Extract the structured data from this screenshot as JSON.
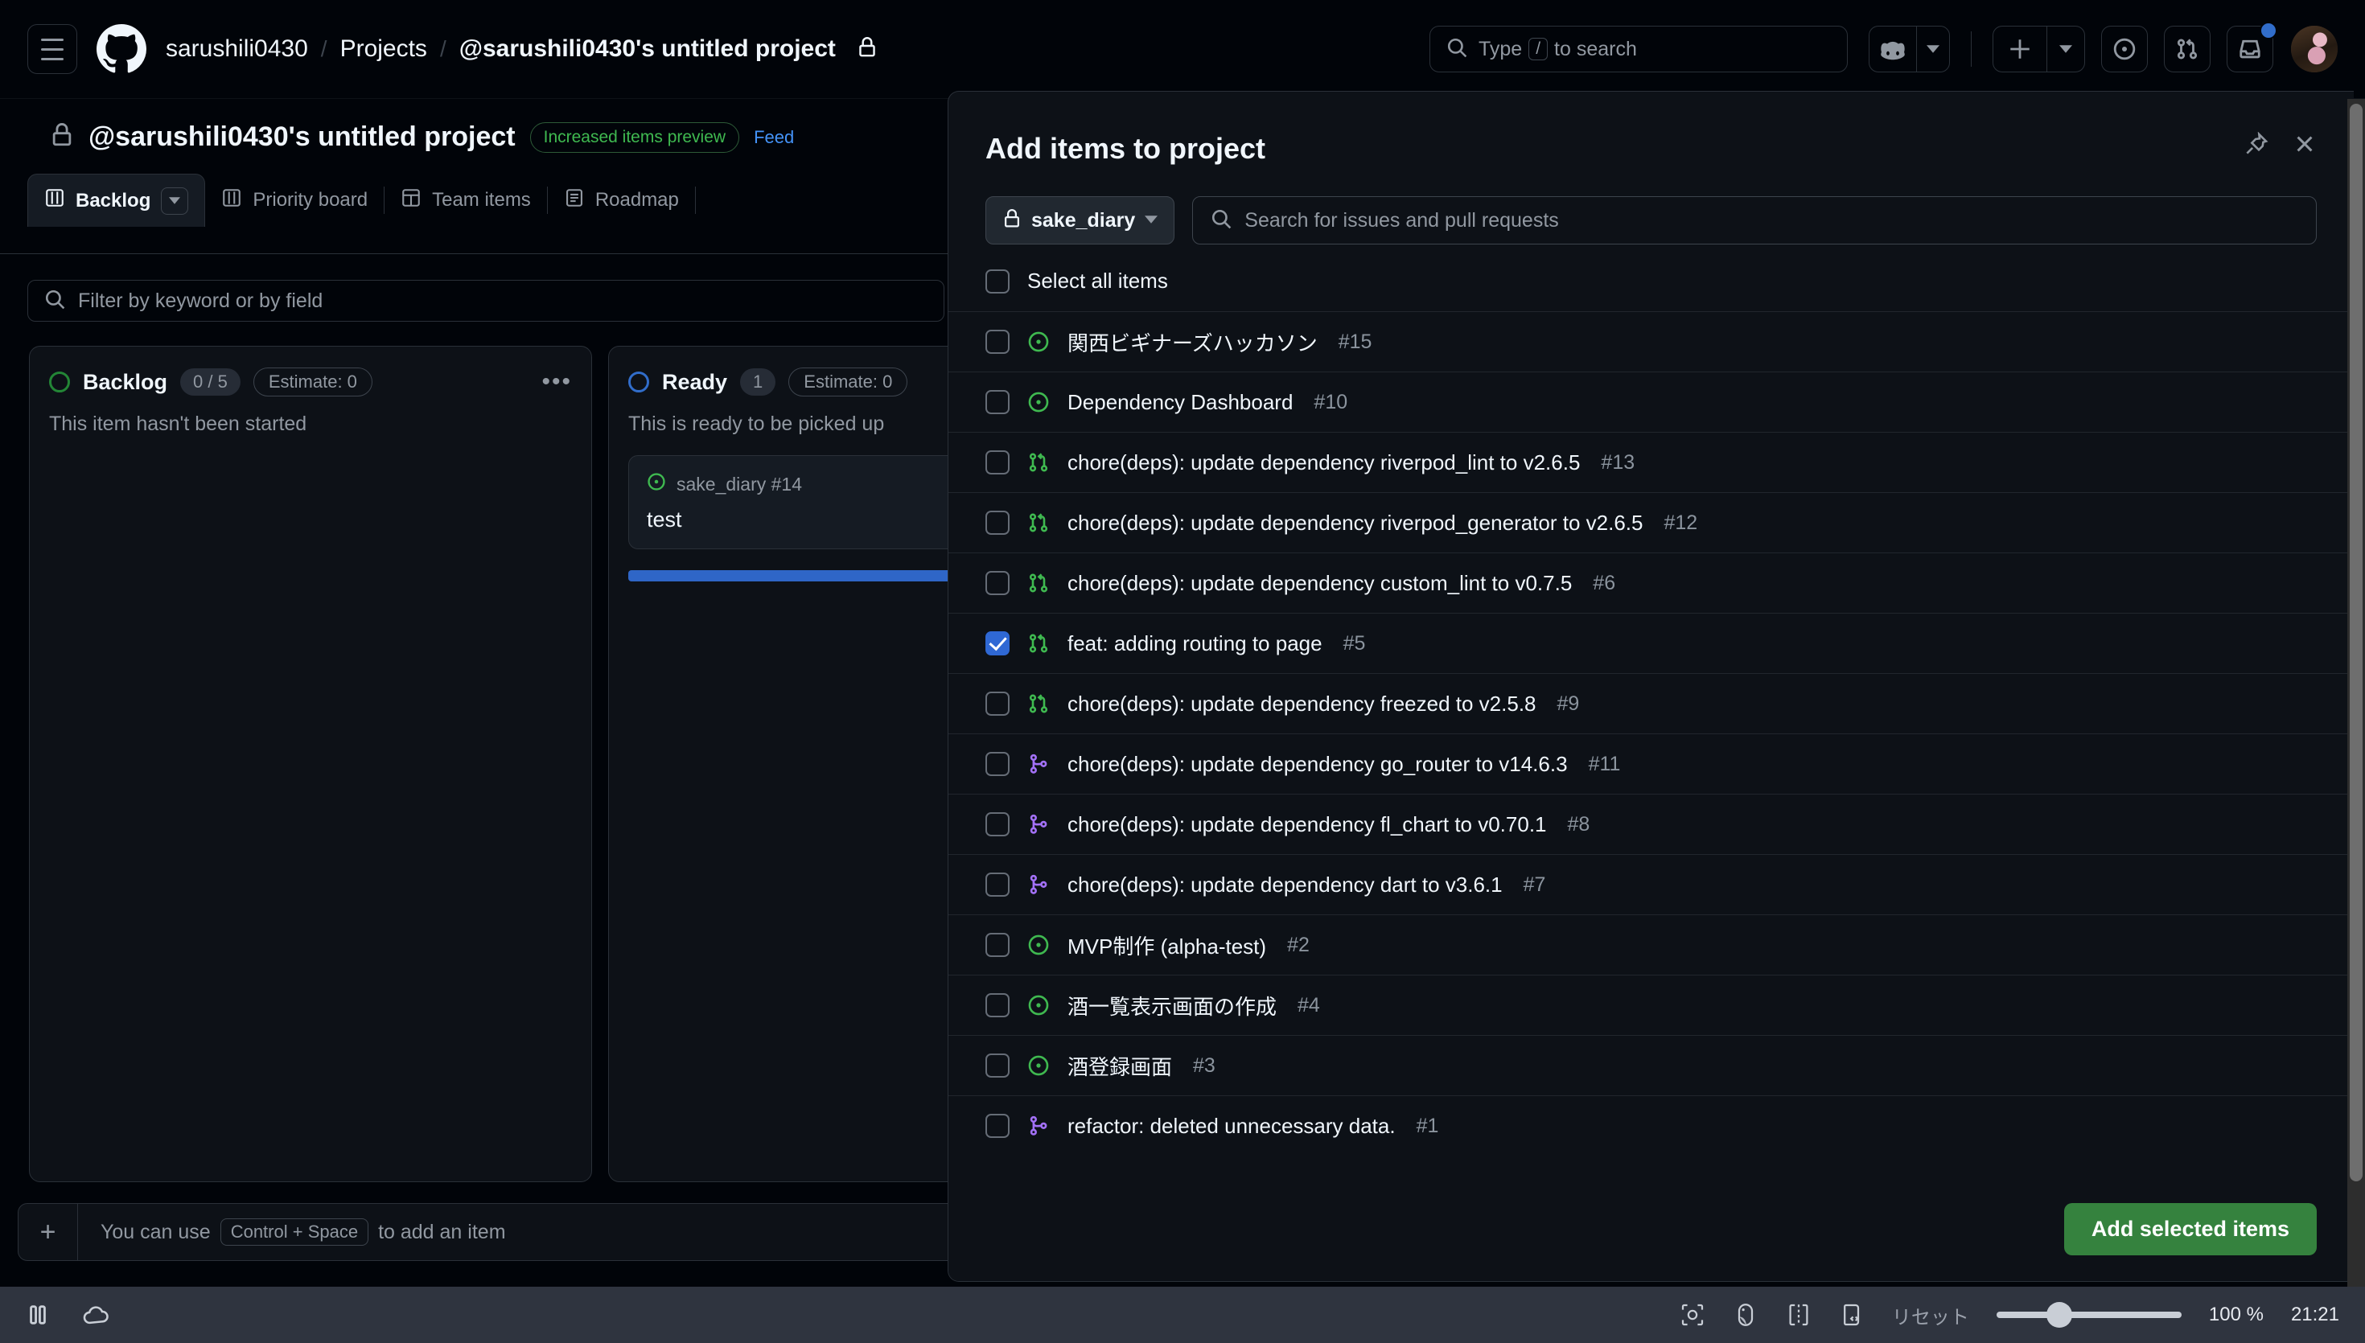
{
  "header": {
    "menu_icon": "hamburger-icon",
    "logo_icon": "github-logo-icon",
    "breadcrumb": {
      "owner": "sarushili0430",
      "sep": "/",
      "section": "Projects",
      "project": "@sarushili0430's untitled project",
      "lock_icon": "lock-icon"
    },
    "search": {
      "placeholder_prefix": "Type",
      "key": "/",
      "placeholder_suffix": "to search",
      "icon": "search-icon"
    },
    "copilot_icon": "copilot-icon",
    "copilot_caret_icon": "chevron-down-icon",
    "plus_icon": "plus-icon",
    "plus_caret_icon": "chevron-down-icon",
    "issues_icon": "issue-opened-icon",
    "pulls_icon": "git-pull-request-icon",
    "inbox_icon": "inbox-icon",
    "avatar_icon": "avatar"
  },
  "project": {
    "lock_icon": "lock-icon",
    "title": "@sarushili0430's untitled project",
    "preview_badge": "Increased items preview",
    "feedback_link": "Feed",
    "tabs": [
      {
        "label": "Backlog",
        "icon": "board-view-icon",
        "active": true,
        "has_caret": true
      },
      {
        "label": "Priority board",
        "icon": "board-view-icon",
        "active": false,
        "has_caret": false
      },
      {
        "label": "Team items",
        "icon": "table-view-icon",
        "active": false,
        "has_caret": false
      },
      {
        "label": "Roadmap",
        "icon": "roadmap-view-icon",
        "active": false,
        "has_caret": false
      }
    ],
    "filter": {
      "placeholder": "Filter by keyword or by field",
      "icon": "search-icon"
    },
    "columns": [
      {
        "name": "Backlog",
        "count": "0 / 5",
        "estimate": "Estimate: 0",
        "description": "This item hasn't been started",
        "dot_color": "#238636",
        "menu_icon": "kebab-horizontal-icon",
        "cards": []
      },
      {
        "name": "Ready",
        "count": "1",
        "estimate": "Estimate: 0",
        "description": "This is ready to be picked up",
        "dot_color": "#316dca",
        "menu_icon": "kebab-horizontal-icon",
        "cards": [
          {
            "repo_ref": "sake_diary #14",
            "title": "test",
            "icon": "issue-opened-icon"
          }
        ]
      }
    ],
    "add_item": {
      "plus_icon": "plus-icon",
      "hint_before": "You can use",
      "kbd": "Control + Space",
      "hint_after": "to add an item"
    }
  },
  "dialog": {
    "title": "Add items to project",
    "pin_icon": "pin-icon",
    "close_icon": "close-icon",
    "repo_selector": {
      "label": "sake_diary",
      "lock_icon": "lock-icon",
      "caret_icon": "chevron-down-icon"
    },
    "search": {
      "placeholder": "Search for issues and pull requests",
      "icon": "search-icon"
    },
    "select_all_label": "Select all items",
    "select_all_checked": false,
    "items": [
      {
        "title": "関西ビギナーズハッカソン",
        "number": "#15",
        "icon": "issue-opened-icon",
        "icon_color": "#3fb950",
        "checked": false
      },
      {
        "title": "Dependency Dashboard",
        "number": "#10",
        "icon": "issue-opened-icon",
        "icon_color": "#3fb950",
        "checked": false
      },
      {
        "title": "chore(deps): update dependency riverpod_lint to v2.6.5",
        "number": "#13",
        "icon": "git-pull-request-icon",
        "icon_color": "#3fb950",
        "checked": false
      },
      {
        "title": "chore(deps): update dependency riverpod_generator to v2.6.5",
        "number": "#12",
        "icon": "git-pull-request-icon",
        "icon_color": "#3fb950",
        "checked": false
      },
      {
        "title": "chore(deps): update dependency custom_lint to v0.7.5",
        "number": "#6",
        "icon": "git-pull-request-icon",
        "icon_color": "#3fb950",
        "checked": false
      },
      {
        "title": "feat: adding routing to page",
        "number": "#5",
        "icon": "git-pull-request-icon",
        "icon_color": "#3fb950",
        "checked": true
      },
      {
        "title": "chore(deps): update dependency freezed to v2.5.8",
        "number": "#9",
        "icon": "git-pull-request-icon",
        "icon_color": "#3fb950",
        "checked": false
      },
      {
        "title": "chore(deps): update dependency go_router to v14.6.3",
        "number": "#11",
        "icon": "git-merge-icon",
        "icon_color": "#a371f7",
        "checked": false
      },
      {
        "title": "chore(deps): update dependency fl_chart to v0.70.1",
        "number": "#8",
        "icon": "git-merge-icon",
        "icon_color": "#a371f7",
        "checked": false
      },
      {
        "title": "chore(deps): update dependency dart to v3.6.1",
        "number": "#7",
        "icon": "git-merge-icon",
        "icon_color": "#a371f7",
        "checked": false
      },
      {
        "title": "MVP制作 (alpha-test)",
        "number": "#2",
        "icon": "issue-opened-icon",
        "icon_color": "#3fb950",
        "checked": false
      },
      {
        "title": "酒一覧表示画面の作成",
        "number": "#4",
        "icon": "issue-opened-icon",
        "icon_color": "#3fb950",
        "checked": false
      },
      {
        "title": "酒登録画面",
        "number": "#3",
        "icon": "issue-opened-icon",
        "icon_color": "#3fb950",
        "checked": false
      },
      {
        "title": "refactor: deleted unnecessary data.",
        "number": "#1",
        "icon": "git-merge-icon",
        "icon_color": "#a371f7",
        "checked": false
      }
    ],
    "submit_label": "Add selected items",
    "submit_color": "#35823e"
  },
  "taskbar": {
    "pause_icon": "pause-icon",
    "cloud_icon": "cloud-icon",
    "screenshot_icon": "screenshot-icon",
    "mouse_icon": "mouse-icon",
    "selection_icon": "selection-icon",
    "devtools_icon": "devtools-icon",
    "reset_label": "リセット",
    "zoom_level": "100 %",
    "clock": "21:21"
  }
}
